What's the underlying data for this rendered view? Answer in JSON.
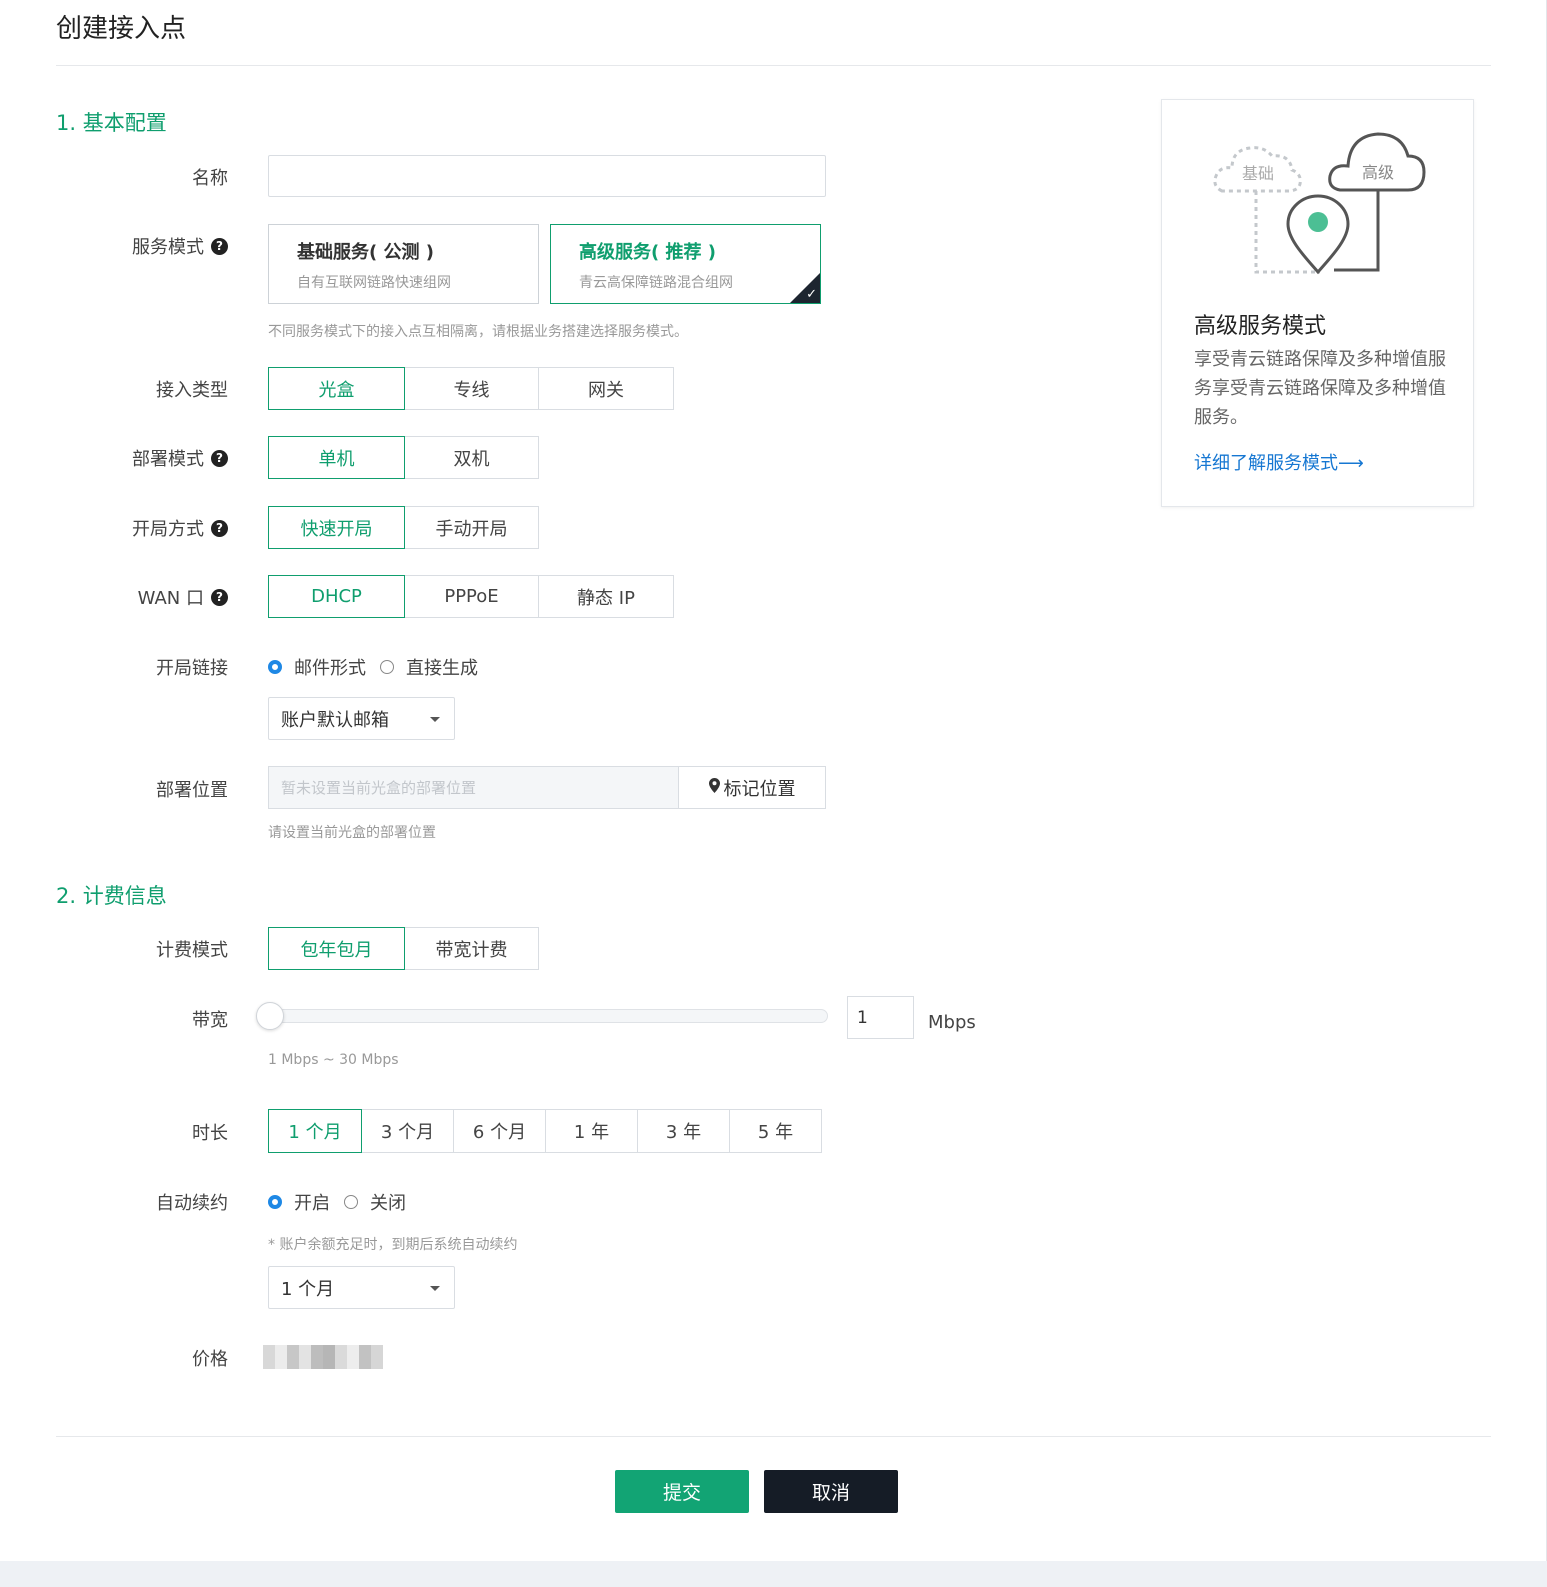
{
  "page": {
    "title": "创建接入点"
  },
  "colors": {
    "accent": "#0f9e6e",
    "link": "#1677d2",
    "dark_button": "#151c26",
    "radio_checked": "#1e88e5"
  },
  "sections": {
    "basic": "1. 基本配置",
    "billing": "2. 计费信息"
  },
  "form": {
    "name_label": "名称",
    "service_mode_label": "服务模式",
    "service_modes": [
      {
        "title": "基础服务( 公测 )",
        "subtitle": "自有互联网链路快速组网",
        "selected": false
      },
      {
        "title": "高级服务( 推荐 )",
        "subtitle": "青云高保障链路混合组网",
        "selected": true
      }
    ],
    "service_mode_hint": "不同服务模式下的接入点互相隔离，请根据业务搭建选择服务模式。",
    "access_type_label": "接入类型",
    "access_types": [
      "光盒",
      "专线",
      "网关"
    ],
    "deploy_mode_label": "部署模式",
    "deploy_modes": [
      "单机",
      "双机"
    ],
    "open_method_label": "开局方式",
    "open_methods": [
      "快速开局",
      "手动开局"
    ],
    "wan_label": "WAN 口",
    "wan_modes": [
      "DHCP",
      "PPPoE",
      "静态 IP"
    ],
    "open_link_label": "开局链接",
    "open_link_options": [
      "邮件形式",
      "直接生成"
    ],
    "email_select_value": "账户默认邮箱",
    "location_label": "部署位置",
    "location_placeholder": "暂未设置当前光盒的部署位置",
    "location_button": "标记位置",
    "location_hint": "请设置当前光盒的部署位置",
    "billing_mode_label": "计费模式",
    "billing_modes": [
      "包年包月",
      "带宽计费"
    ],
    "bandwidth_label": "带宽",
    "bandwidth_value": "1",
    "bandwidth_unit": "Mbps",
    "bandwidth_range": "1 Mbps ~ 30 Mbps",
    "bandwidth_slider_fraction": 0.0,
    "duration_label": "时长",
    "durations": [
      "1 个月",
      "3 个月",
      "6 个月",
      "1 年",
      "3 年",
      "5 年"
    ],
    "auto_renew_label": "自动续约",
    "auto_renew_options": [
      "开启",
      "关闭"
    ],
    "auto_renew_hint": "* 账户余额充足时，到期后系统自动续约",
    "renew_period_value": "1 个月",
    "price_label": "价格"
  },
  "actions": {
    "submit": "提交",
    "cancel": "取消"
  },
  "info_card": {
    "illus_basic": "基础",
    "illus_advanced": "高级",
    "title": "高级服务模式",
    "description": "享受青云链路保障及多种增值服务享受青云链路保障及多种增值服务。",
    "link": "详细了解服务模式⟶"
  }
}
